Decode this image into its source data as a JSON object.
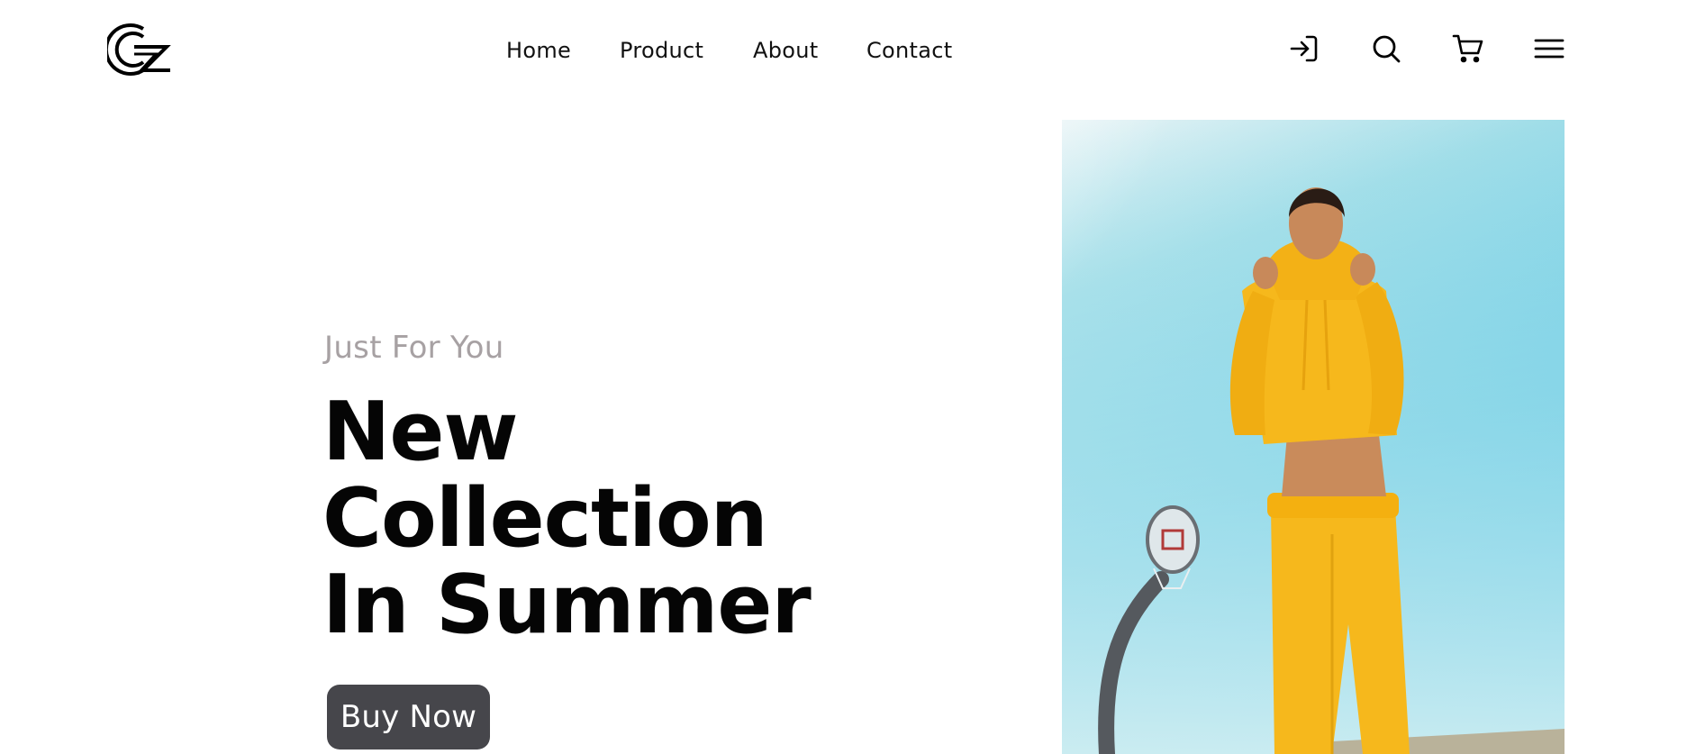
{
  "header": {
    "nav": [
      {
        "label": "Home"
      },
      {
        "label": "Product"
      },
      {
        "label": "About"
      },
      {
        "label": "Contact"
      }
    ],
    "icons": [
      "logo-icon",
      "login-icon",
      "search-icon",
      "cart-icon",
      "menu-icon"
    ]
  },
  "hero": {
    "subtitle": "Just For You",
    "headline": [
      "New",
      "Collection",
      "In Summer"
    ],
    "cta_label": "Buy Now",
    "colors": {
      "button_bg": "#46464b",
      "subtitle": "#a7a1a3",
      "sky": "#62c9e3",
      "outfit": "#f6b81c"
    }
  }
}
